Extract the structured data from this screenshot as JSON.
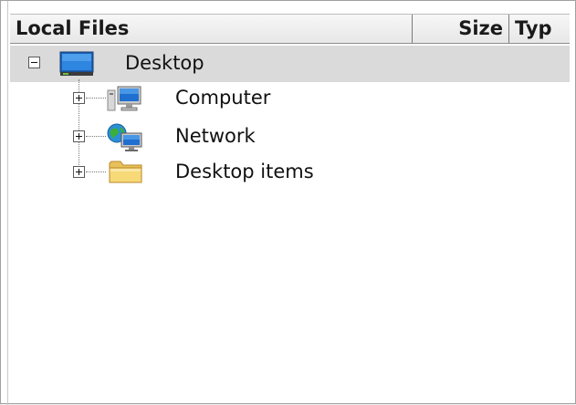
{
  "header": {
    "name_label": "Local Files",
    "size_label": "Size",
    "type_label": "Typ"
  },
  "tree": {
    "root": {
      "label": "Desktop",
      "expanded": true,
      "icon": "desktop-icon"
    },
    "children": [
      {
        "label": "Computer",
        "expanded": false,
        "icon": "computer-icon"
      },
      {
        "label": "Network",
        "expanded": false,
        "icon": "network-icon"
      },
      {
        "label": "Desktop items",
        "expanded": false,
        "icon": "folder-icon"
      }
    ]
  }
}
